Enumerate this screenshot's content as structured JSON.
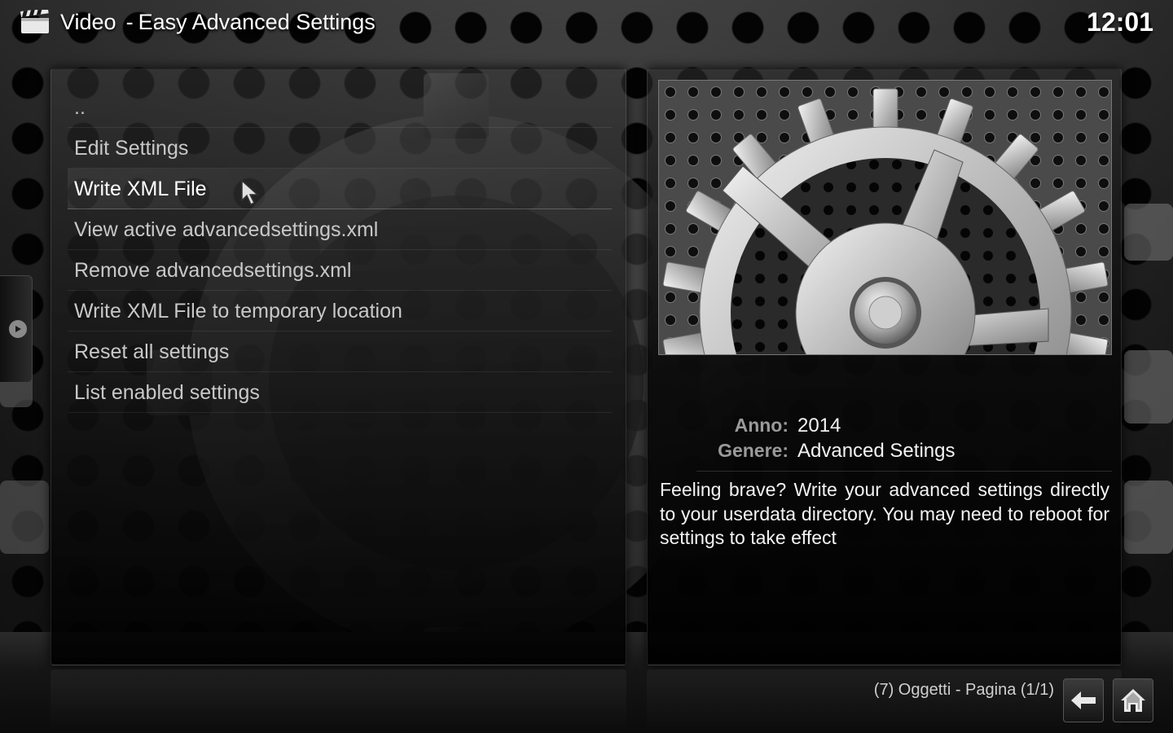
{
  "header": {
    "section": "Video",
    "separator": "-",
    "addon_title": "Easy Advanced Settings",
    "clock": "12:01",
    "app_icon": "clapperboard-icon"
  },
  "list": {
    "items": [
      {
        "label": ".."
      },
      {
        "label": "Edit Settings"
      },
      {
        "label": "Write XML File"
      },
      {
        "label": "View active advancedsettings.xml"
      },
      {
        "label": "Remove advancedsettings.xml"
      },
      {
        "label": "Write XML File to temporary location"
      },
      {
        "label": "Reset all settings"
      },
      {
        "label": "List enabled settings"
      }
    ],
    "focused_index": 2
  },
  "info": {
    "thumbnail_icon": "gear-icon",
    "year_label": "Anno:",
    "year_value": "2014",
    "genre_label": "Genere:",
    "genre_value": "Advanced Setings",
    "plot": "Feeling brave? Write your advanced settings directly to your userdata directory. You may need to reboot for settings to take effect"
  },
  "footer": {
    "pager": "(7) Oggetti - Pagina (1/1)",
    "back_icon": "back-arrow-icon",
    "home_icon": "home-icon"
  },
  "colors": {
    "background": "#161616",
    "text_primary": "#ffffff",
    "text_dim": "#c8c8c8",
    "label_gray": "#9a9a9a"
  }
}
